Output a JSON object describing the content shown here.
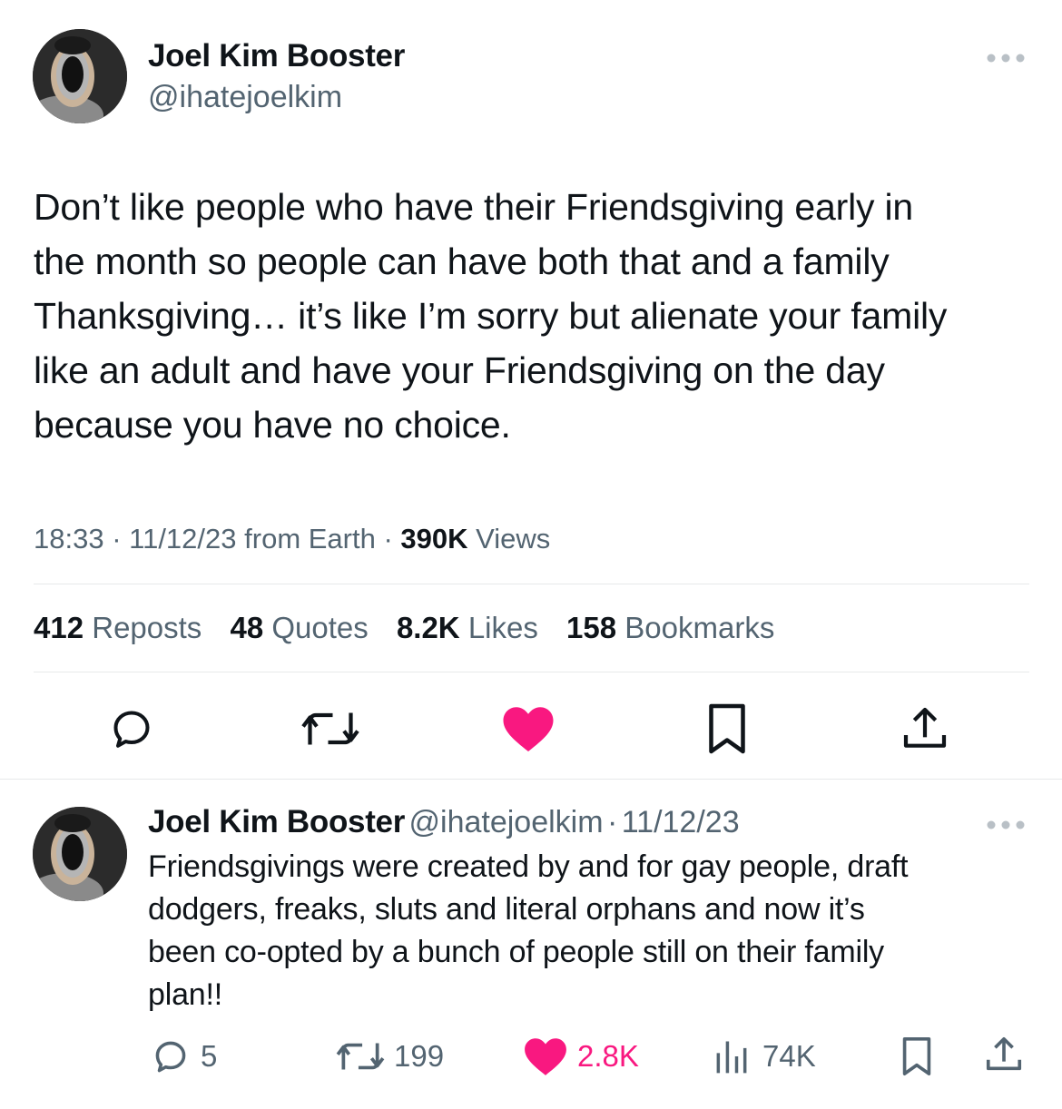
{
  "main_tweet": {
    "author_name": "Joel Kim Booster",
    "author_handle": "@ihatejoelkim",
    "text_lines": [
      "Don’t like people who have their Friendsgiving early in",
      "the month so people can have both that and a family",
      "Thanksgiving… it’s like I’m sorry but alienate your family",
      "like an adult and have your Friendsgiving on the day",
      "because you have no choice."
    ],
    "time": "18:33",
    "date": "11/12/23",
    "source": "from Earth",
    "views_count": "390K",
    "views_label": "Views",
    "stats": [
      {
        "count": "412",
        "label": "Reposts"
      },
      {
        "count": "48",
        "label": "Quotes"
      },
      {
        "count": "8.2K",
        "label": "Likes"
      },
      {
        "count": "158",
        "label": "Bookmarks"
      }
    ]
  },
  "reply": {
    "author_name": "Joel Kim Booster",
    "author_handle": "@ihatejoelkim",
    "separator": "·",
    "date": "11/12/23",
    "text_lines": [
      "Friendsgivings were created by and for gay people, draft",
      "dodgers, freaks, sluts and literal orphans and now it’s",
      "been co-opted by a bunch of people still on their family",
      "plan!!"
    ],
    "reply_count": "5",
    "repost_count": "199",
    "like_count": "2.8K",
    "view_count": "74K"
  },
  "colors": {
    "text": "#0f1419",
    "secondary": "#536471",
    "like_pink": "#f91880",
    "divider": "#e7e9ea"
  },
  "icons": [
    "more-icon",
    "reply-icon",
    "repost-icon",
    "like-icon",
    "bookmark-icon",
    "share-icon",
    "views-icon"
  ]
}
